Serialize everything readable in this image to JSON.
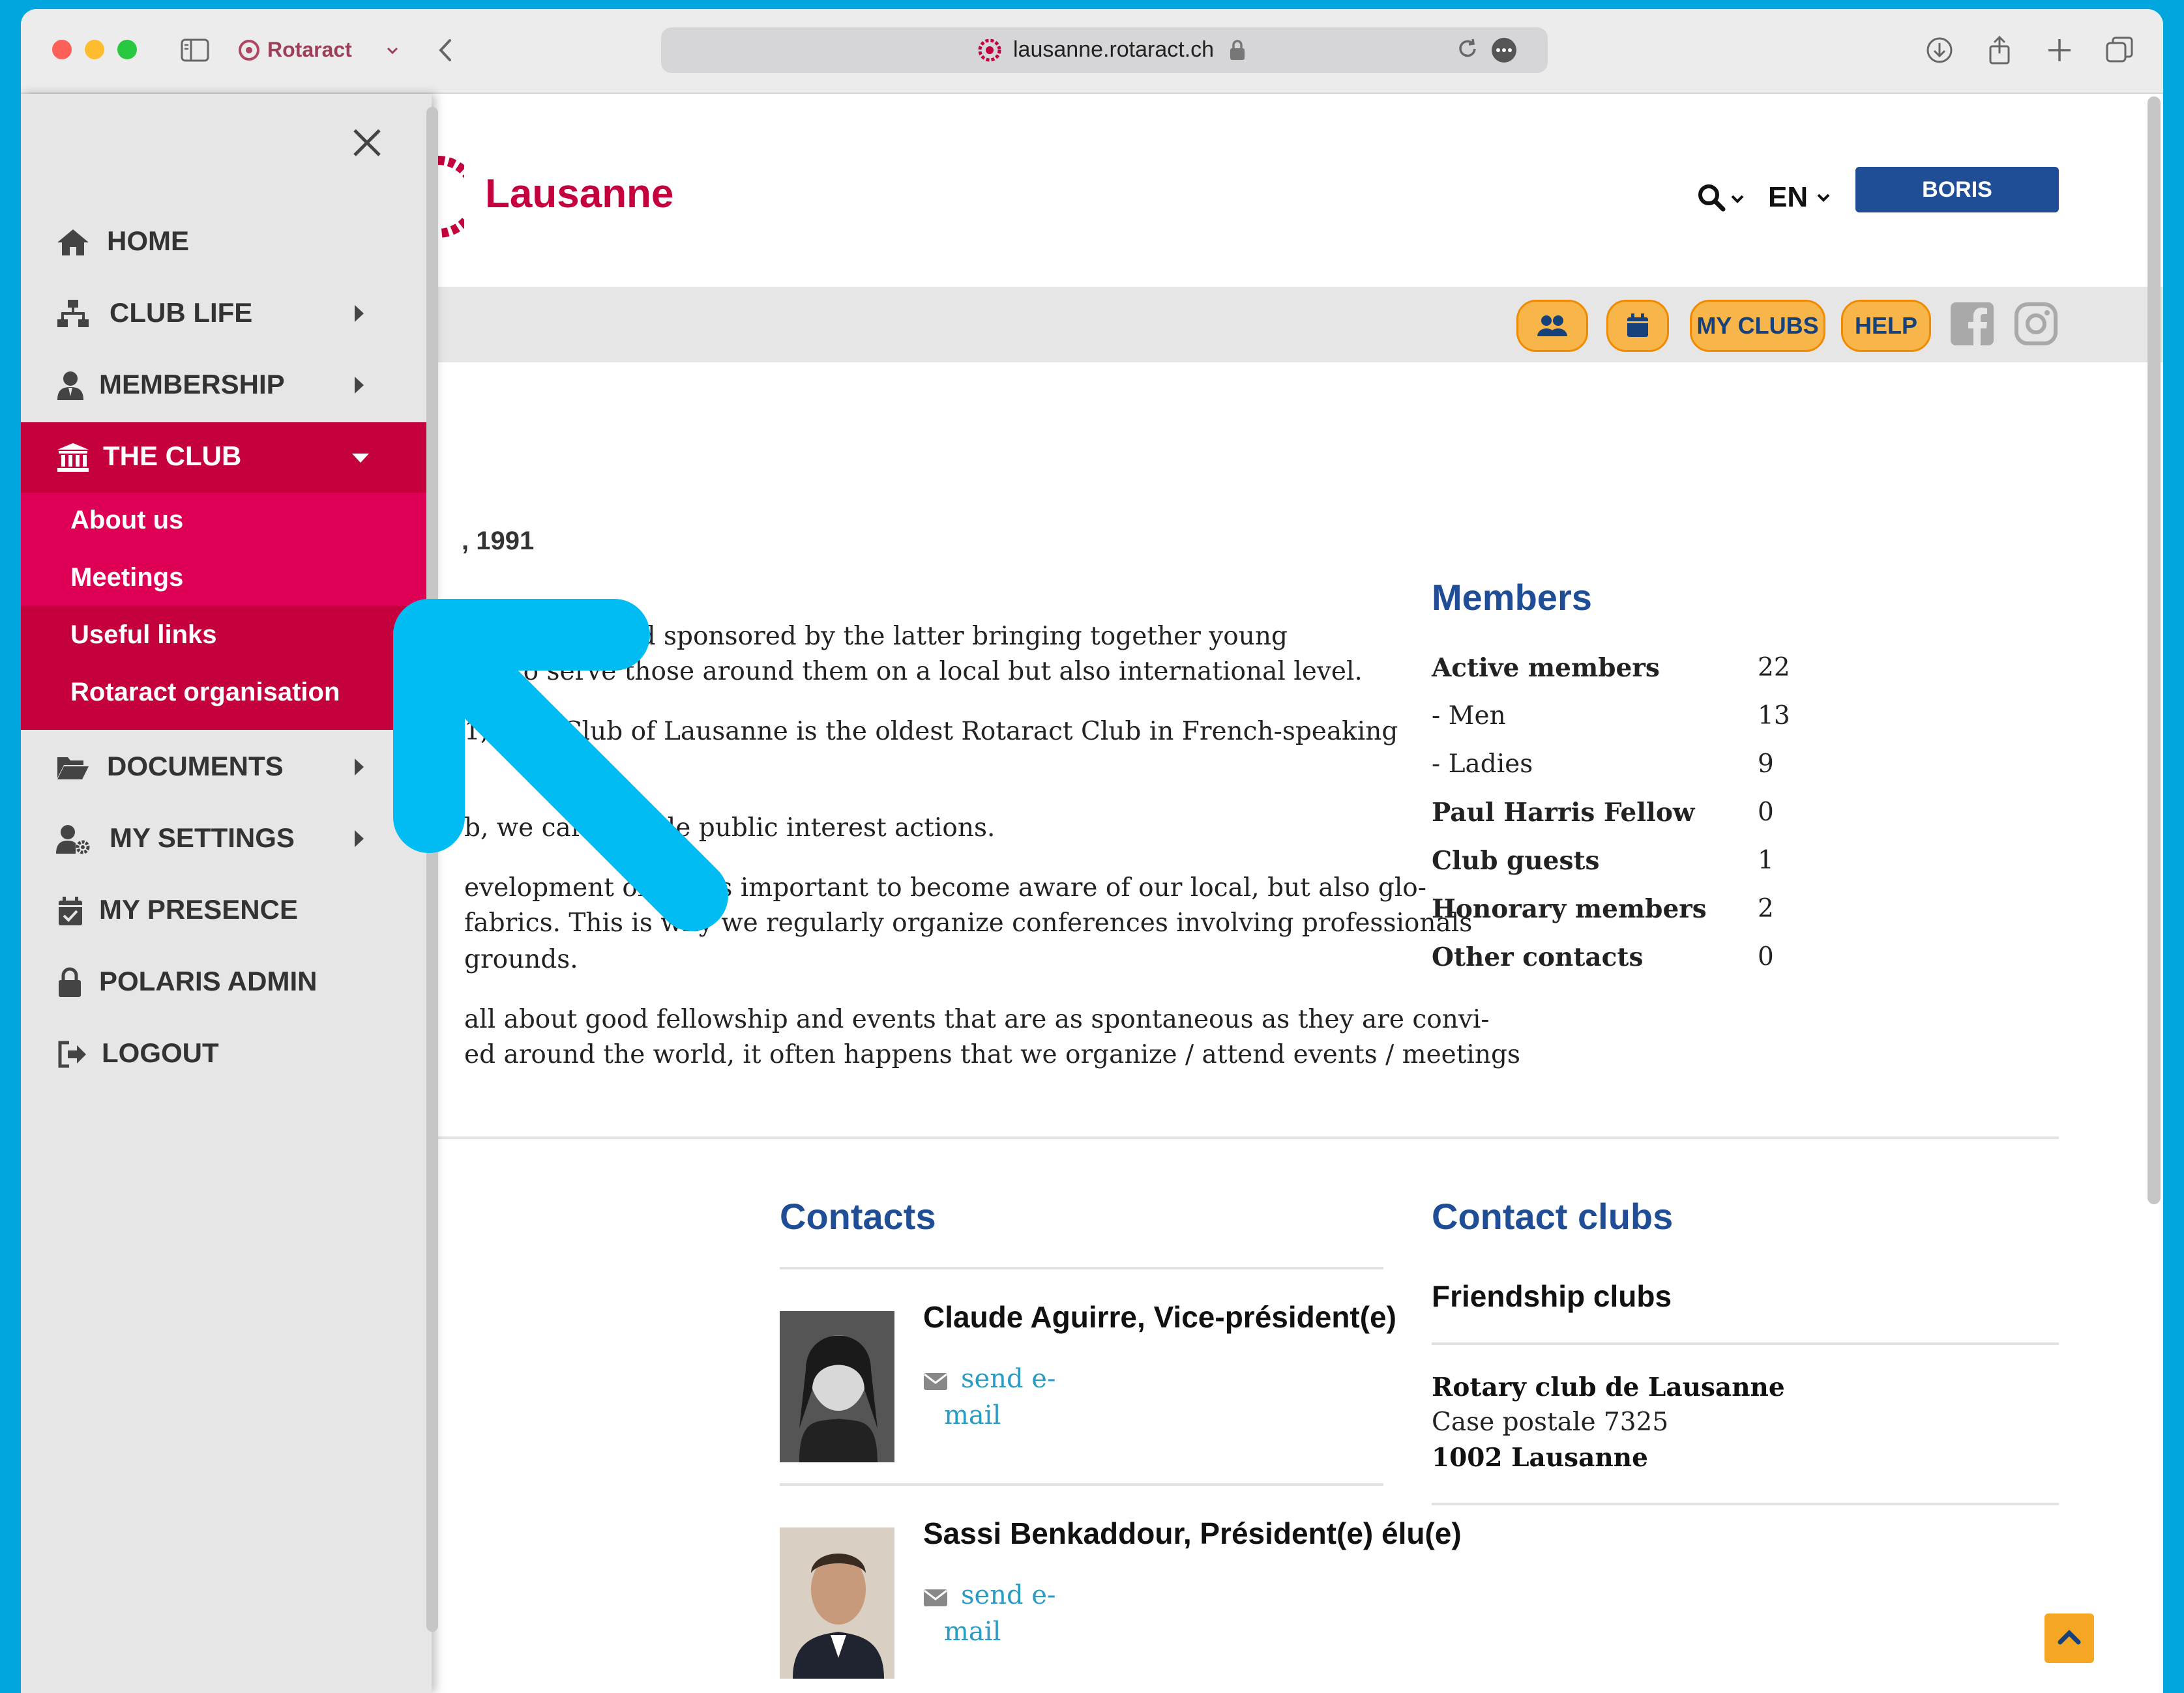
{
  "browser": {
    "tab_label": "Rotaract",
    "url": "lausanne.rotaract.ch"
  },
  "site": {
    "club_name": "Lausanne",
    "language": "EN",
    "user_button": "BORIS FERNANDEZ",
    "toolbar": {
      "my_clubs": "MY CLUBS",
      "help": "HELP"
    },
    "brand_color": "#c4003d",
    "accent_blue": "#1f4e96"
  },
  "sidebar": {
    "items": [
      {
        "label": "HOME",
        "icon": "home-icon"
      },
      {
        "label": "CLUB LIFE",
        "icon": "sitemap-icon"
      },
      {
        "label": "MEMBERSHIP",
        "icon": "user-tie-icon"
      },
      {
        "label": "THE CLUB",
        "icon": "institution-icon"
      },
      {
        "label": "DOCUMENTS",
        "icon": "folder-open-icon"
      },
      {
        "label": "MY SETTINGS",
        "icon": "user-cog-icon"
      },
      {
        "label": "MY PRESENCE",
        "icon": "calendar-check-icon"
      },
      {
        "label": "POLARIS ADMIN",
        "icon": "lock-icon"
      },
      {
        "label": "LOGOUT",
        "icon": "sign-out-icon"
      }
    ],
    "the_club_submenu": [
      "About us",
      "Meetings",
      "Useful links",
      "Rotaract organisation"
    ]
  },
  "about": {
    "founded_fragment": ", 1991",
    "lines": [
      "otary Club and sponsored by the latter bringing together young",
      "ing to serve those around them on a local but also international level.",
      "1, t        act Club of Lausanne is the oldest Rotaract Club in French-speaking",
      "b, we carry            itable public interest actions.",
      "evelopment obje         it is important to become aware of our local, but also glo-",
      "fabrics. This is why we regularly organize conferences involving professionals",
      "grounds.",
      "all about good fellowship and events that are as spontaneous as they are convi-",
      "ed around the world, it often happens that we organize / attend events / meetings"
    ]
  },
  "members": {
    "title": "Members",
    "rows": [
      {
        "label": "Active members",
        "value": "22",
        "bold": true
      },
      {
        "label": "- Men",
        "value": "13",
        "bold": false
      },
      {
        "label": "- Ladies",
        "value": "9",
        "bold": false
      },
      {
        "label": "Paul Harris Fellow",
        "value": "0",
        "bold": true
      },
      {
        "label": "Club guests",
        "value": "1",
        "bold": true
      },
      {
        "label": "Honorary members",
        "value": "2",
        "bold": true
      },
      {
        "label": "Other contacts",
        "value": "0",
        "bold": true
      }
    ]
  },
  "contacts": {
    "title": "Contacts",
    "people": [
      {
        "name": "Claude Aguirre, Vice-président(e)",
        "mail_line1": "send e-",
        "mail_line2": "mail"
      },
      {
        "name": "Sassi Benkaddour, Président(e) élu(e)",
        "mail_line1": "send e-",
        "mail_line2": "mail"
      }
    ]
  },
  "contact_clubs": {
    "title": "Contact clubs",
    "subtitle": "Friendship clubs",
    "club_name": "Rotary club de Lausanne",
    "address_line1": "Case postale 7325",
    "address_line2": "1002 Lausanne"
  }
}
